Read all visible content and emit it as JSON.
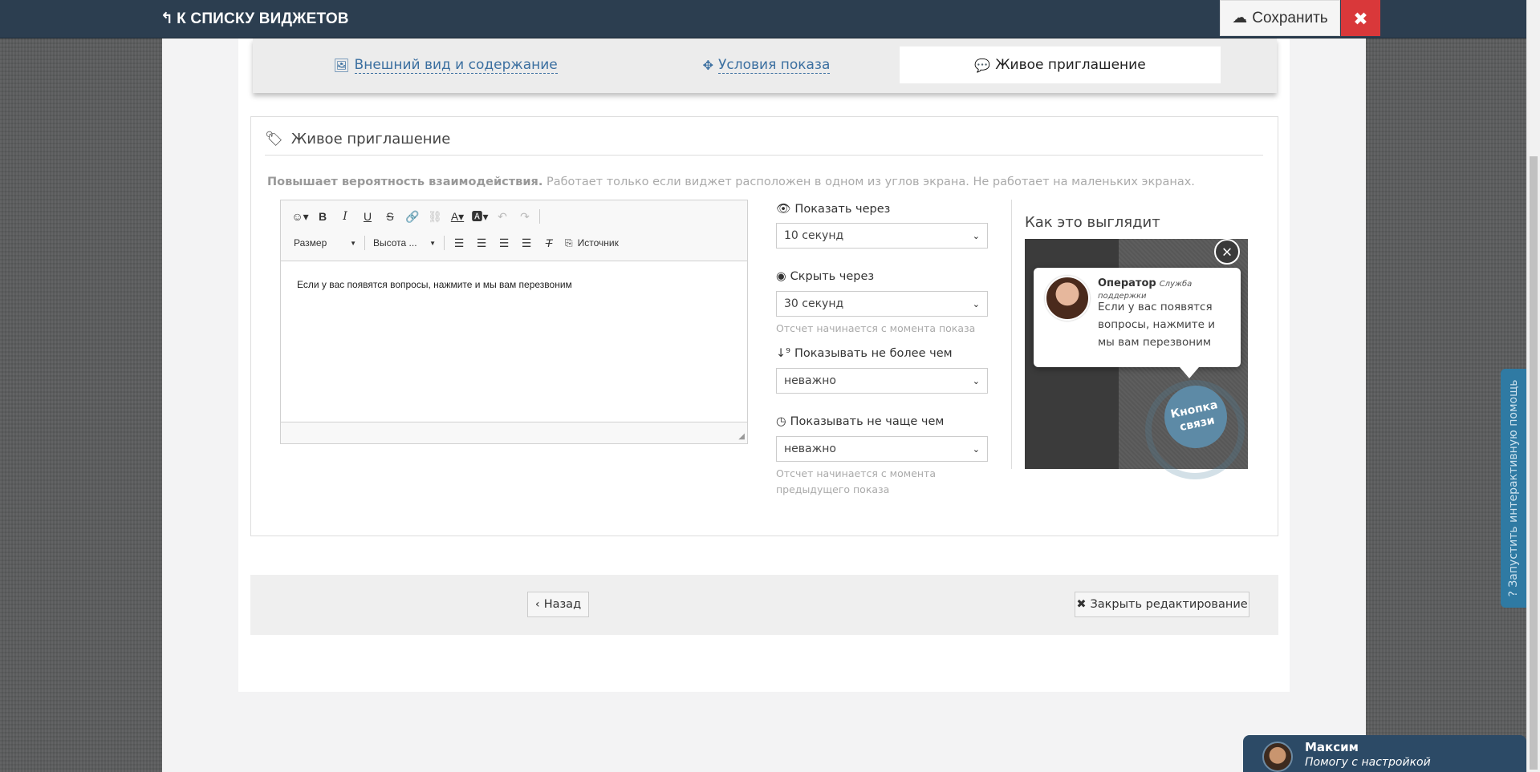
{
  "topbar": {
    "back_label": "К СПИСКУ ВИДЖЕТОВ",
    "save_label": "Сохранить",
    "close_label": "✖"
  },
  "tabs": [
    {
      "label": "Внешний вид и содержание",
      "icon": "image-icon",
      "active": false
    },
    {
      "label": "Условия показа",
      "icon": "crosshair-icon",
      "active": false
    },
    {
      "label": "Живое приглашение",
      "icon": "comment-icon",
      "active": true
    }
  ],
  "section": {
    "title": "Живое приглашение",
    "desc_bold": "Повышает вероятность взаимодействия.",
    "desc_rest": " Работает только если виджет расположен в одном из углов экрана. Не работает на маленьких экранах."
  },
  "editor": {
    "size_label": "Размер",
    "height_label": "Высота ...",
    "source_label": "Источник",
    "content": "Если у вас появятся вопросы, нажмите и мы вам перезвоним"
  },
  "form": {
    "show_after_label": "Показать через",
    "show_after_value": "10 секунд",
    "hide_after_label": "Скрыть через",
    "hide_after_value": "30 секунд",
    "hide_after_help": "Отсчет начинается с момента показа",
    "max_times_label": "Показывать не более чем",
    "max_times_value": "неважно",
    "min_interval_label": "Показывать не чаще чем",
    "min_interval_value": "неважно",
    "min_interval_help_1": "Отсчет начинается с момента",
    "min_interval_help_2": "предыдущего показа"
  },
  "preview": {
    "title": "Как это выглядит",
    "operator_name": "Оператор",
    "operator_role": "Служба поддержки",
    "message": "Если у вас появятся вопросы, нажмите и мы вам перезвоним",
    "call_button_line1": "Кнопка",
    "call_button_line2": "связи"
  },
  "footer": {
    "back_label": "Назад",
    "close_edit_label": "Закрыть редактирование"
  },
  "side_help": {
    "label": "? Запустить интерактивную помощь"
  },
  "chat": {
    "name": "Максим",
    "subtitle": "Помогу с настройкой"
  },
  "colors": {
    "topbar": "#2c3e50",
    "close": "#d9383a",
    "link": "#3b6fa0",
    "side_help": "#2f7aa3",
    "chat": "#2c4a66"
  }
}
